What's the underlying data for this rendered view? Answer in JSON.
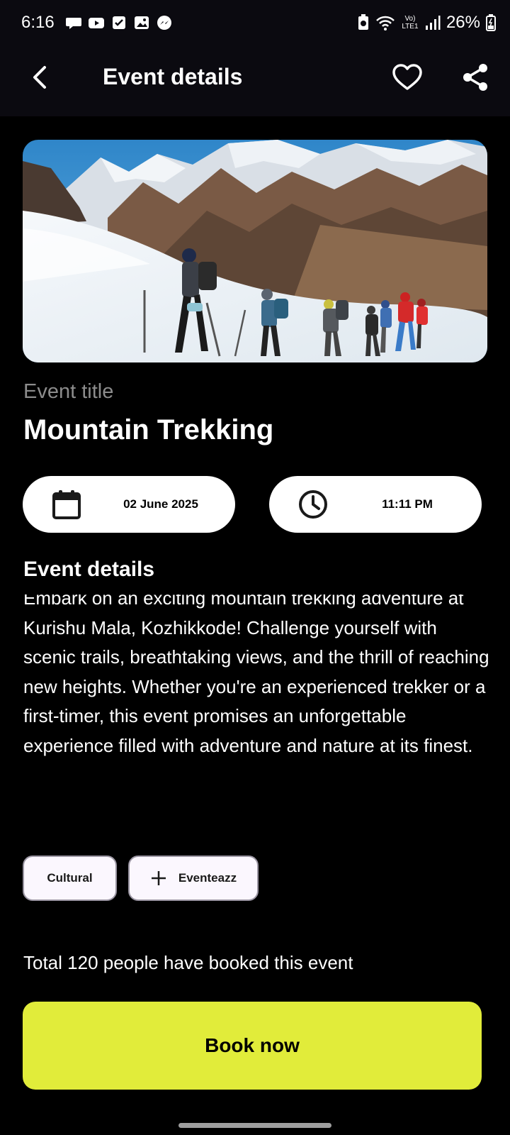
{
  "status_bar": {
    "time": "6:16",
    "network_label": "Vo) LTE1",
    "battery": "26%",
    "left_icons": [
      "chat-bubble-icon",
      "youtube-icon",
      "checkbox-icon",
      "gallery-icon",
      "messenger-icon"
    ],
    "right_icons": [
      "battery-saver-icon",
      "wifi-icon",
      "network-type-icon",
      "signal-icon",
      "battery-icon"
    ]
  },
  "app_bar": {
    "title": "Event details",
    "back_icon": "back-arrow-icon",
    "favorite_icon": "heart-icon",
    "share_icon": "share-icon"
  },
  "event": {
    "label": "Event title",
    "title": "Mountain Trekking",
    "date": "02 June 2025",
    "time": "11:11 PM",
    "date_icon": "calendar-icon",
    "time_icon": "clock-icon",
    "details_heading": "Event details",
    "description": "Embark on an exciting mountain trekking adventure at Kurishu Mala, Kozhikkode! Challenge yourself with scenic trails, breathtaking views, and the thrill of reaching new heights. Whether you're an experienced trekker or a first-timer, this event promises an unforgettable experience filled with adventure and nature at its finest.",
    "tags": [
      "Cultural",
      "Eventeazz"
    ],
    "booked_text": "Total 120 people have booked this event"
  },
  "actions": {
    "book_label": "Book now"
  },
  "colors": {
    "background": "#000000",
    "app_bar": "#0b0a10",
    "accent": "#e1ec3a",
    "pill_bg": "#ffffff",
    "chip_bg": "#fbf7fe",
    "chip_border": "#9a95a2",
    "muted_text": "#8c8c8c"
  }
}
